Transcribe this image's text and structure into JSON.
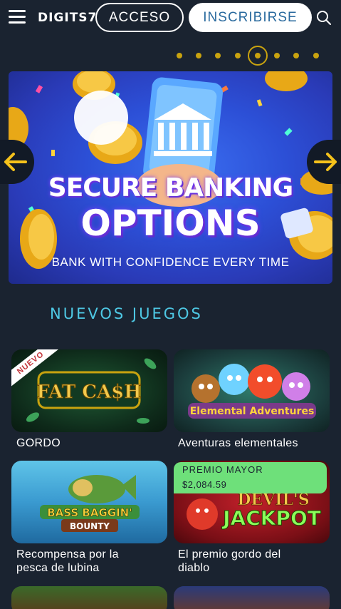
{
  "header": {
    "logo": "DIGITS7",
    "login_label": "ACCESO",
    "signup_label": "INSCRIBIRSE"
  },
  "carousel": {
    "slide_count": 8,
    "active_index": 4,
    "banner": {
      "title_line1": "SECURE BANKING",
      "title_line2": "OPTIONS",
      "subtitle": "BANK WITH CONFIDENCE EVERY TIME"
    }
  },
  "section": {
    "title": "NUEVOS JUEGOS"
  },
  "games": [
    {
      "name": "GORDO",
      "art_text": "FAT CA$H",
      "badge": "NUEVO"
    },
    {
      "name": "Aventuras elementales",
      "art_text": "Elemental Adventures"
    },
    {
      "name": "Recompensa por la pesca de lubina",
      "name_line1": "Recompensa por la",
      "name_line2": "pesca de lubina",
      "art_text_1": "BASS BAGGIN'",
      "art_text_2": "BOUNTY"
    },
    {
      "name": "El premio gordo del diablo",
      "name_line1": "El premio gordo del",
      "name_line2": "diablo",
      "art_text_1": "DEVIL'S",
      "art_text_2": "JACKPOT"
    }
  ],
  "jackpot": {
    "title": "PREMIO MAYOR",
    "amount": "$2,084.59"
  },
  "colors": {
    "background": "#1a2330",
    "accent": "#4ec8e4",
    "dot": "#c9a30f",
    "jackpot": "#6ee07a"
  }
}
